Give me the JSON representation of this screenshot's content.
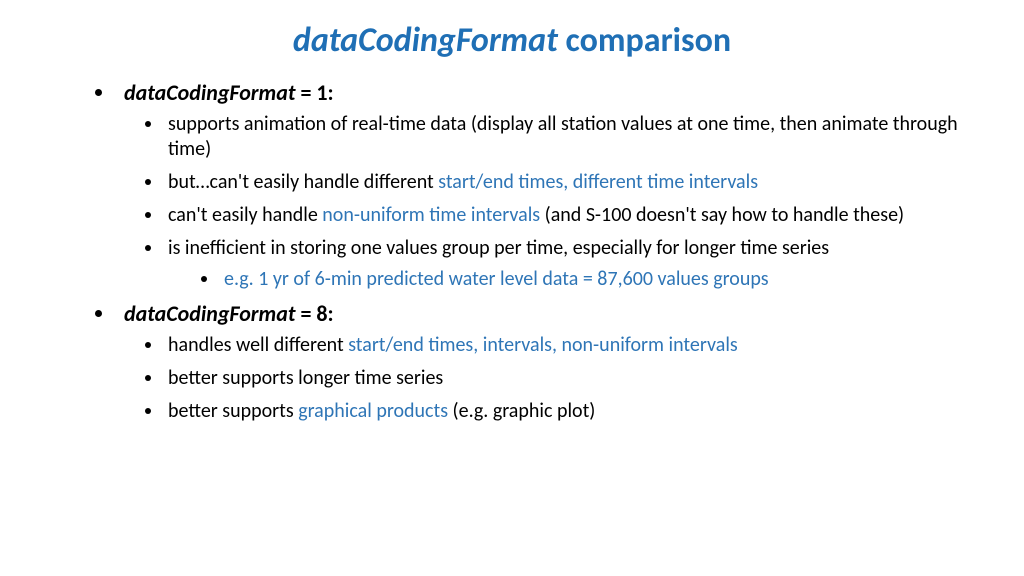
{
  "title": {
    "italic": "dataCodingFormat",
    "rest": " comparison"
  },
  "section1": {
    "heading_italic": "dataCodingFormat",
    "heading_rest": " = 1:",
    "b1": "supports animation of real-time data (display all station values at one time, then animate through time)",
    "b2a": "but…can't easily handle different ",
    "b2b": "start/end times, different time intervals",
    "b3a": "can't easily handle ",
    "b3b": "non-uniform time intervals",
    "b3c": " (and S-100 doesn't say how to handle these)",
    "b4": "is inefficient in storing one values group per time, especially for longer time series",
    "b4sub": "e.g. 1 yr of 6-min predicted water level data = 87,600 values groups"
  },
  "section2": {
    "heading_italic": "dataCodingFormat",
    "heading_rest": " = 8:",
    "b1a": "handles well different ",
    "b1b": "start/end times, intervals, non-uniform intervals",
    "b2": "better supports longer time series",
    "b3a": "better supports ",
    "b3b": "graphical products",
    "b3c": " (e.g. graphic plot)"
  }
}
